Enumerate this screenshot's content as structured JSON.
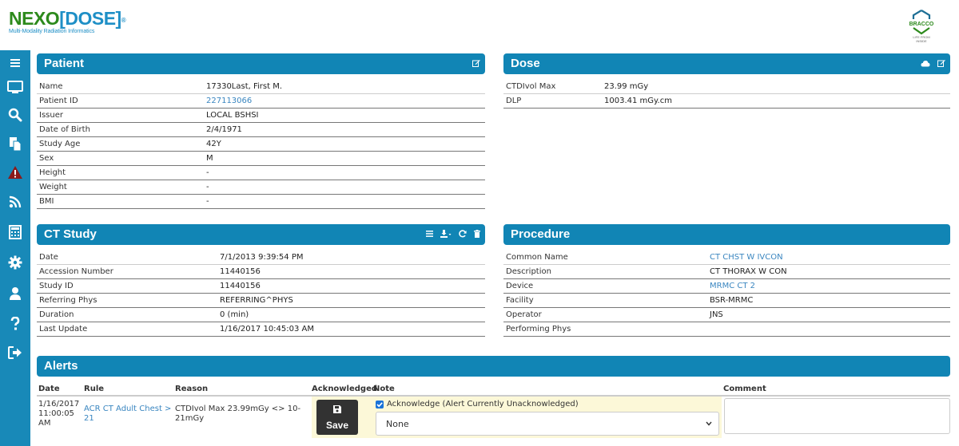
{
  "brand": {
    "logo_nexo": "NEXO",
    "logo_dose": "[DOSE]",
    "logo_reg": "®",
    "tagline": "Multi-Modality Radiation Informatics",
    "partner": "BRACCO",
    "partner_tagline": "LIFE FROM INSIDE"
  },
  "colors": {
    "header_bar": "#1185b5",
    "sidebar": "#1889b8",
    "link": "#3a86c0",
    "highlight_row": "#fcf8d8"
  },
  "sidebar": {
    "items": [
      {
        "name": "menu",
        "icon": "hamburger-icon"
      },
      {
        "name": "monitor",
        "icon": "monitor-icon"
      },
      {
        "name": "search",
        "icon": "search-icon"
      },
      {
        "name": "copy",
        "icon": "copy-icon"
      },
      {
        "name": "alerts",
        "icon": "warning-icon"
      },
      {
        "name": "feed",
        "icon": "rss-icon"
      },
      {
        "name": "calculator",
        "icon": "calculator-icon"
      },
      {
        "name": "settings",
        "icon": "gear-icon"
      },
      {
        "name": "user",
        "icon": "user-icon"
      },
      {
        "name": "help",
        "icon": "question-icon"
      },
      {
        "name": "logout",
        "icon": "sign-out-icon"
      }
    ]
  },
  "patient": {
    "title": "Patient",
    "rows": [
      {
        "label": "Name",
        "value": "17330Last, First M.",
        "link": false
      },
      {
        "label": "Patient ID",
        "value": "227113066",
        "link": true
      },
      {
        "label": "Issuer",
        "value": "LOCAL BSHSI",
        "link": false
      },
      {
        "label": "Date of Birth",
        "value": "2/4/1971",
        "link": false
      },
      {
        "label": "Study Age",
        "value": "42Y",
        "link": false
      },
      {
        "label": "Sex",
        "value": "M",
        "link": false
      },
      {
        "label": "Height",
        "value": "-",
        "link": false
      },
      {
        "label": "Weight",
        "value": "-",
        "link": false
      },
      {
        "label": "BMI",
        "value": "-",
        "link": false
      }
    ]
  },
  "dose": {
    "title": "Dose",
    "rows": [
      {
        "label": "CTDIvol Max",
        "value": "23.99 mGy",
        "link": false
      },
      {
        "label": "DLP",
        "value": "1003.41 mGy.cm",
        "link": false
      }
    ]
  },
  "ct_study": {
    "title": "CT  Study",
    "rows": [
      {
        "label": "Date",
        "value": "7/1/2013 9:39:54 PM",
        "link": false
      },
      {
        "label": "Accession Number",
        "value": "11440156",
        "link": false
      },
      {
        "label": "Study ID",
        "value": "11440156",
        "link": false
      },
      {
        "label": "Referring Phys",
        "value": "REFERRING^PHYS",
        "link": false
      },
      {
        "label": "Duration",
        "value": "0 (min)",
        "link": false
      },
      {
        "label": "Last Update",
        "value": "1/16/2017 10:45:03 AM",
        "link": false
      }
    ]
  },
  "procedure": {
    "title": "Procedure",
    "rows": [
      {
        "label": "Common Name",
        "value": "CT CHST W IVCON",
        "link": true
      },
      {
        "label": "Description",
        "value": "CT THORAX W CON",
        "link": false
      },
      {
        "label": "Device",
        "value": "MRMC CT 2",
        "link": true
      },
      {
        "label": "Facility",
        "value": "BSR-MRMC",
        "link": false
      },
      {
        "label": "Operator",
        "value": "JNS",
        "link": false
      },
      {
        "label": "Performing Phys",
        "value": "",
        "link": false
      }
    ]
  },
  "alerts": {
    "title": "Alerts",
    "columns": {
      "date": "Date",
      "rule": "Rule",
      "reason": "Reason",
      "acknowledged": "Acknowledged",
      "note": "Note",
      "comment": "Comment"
    },
    "row": {
      "date_line1": "1/16/2017",
      "date_line2": "11:00:05",
      "date_line3": "AM",
      "rule_line1": "ACR CT Adult Chest >",
      "rule_line2": "21",
      "reason_line1": "CTDIvol Max 23.99mGy <> 10-",
      "reason_line2": "21mGy",
      "save_label": "Save",
      "ack_checked": true,
      "ack_label": "Acknowledge (Alert Currently Unacknowledged)",
      "note_selected": "None",
      "comment_value": ""
    }
  }
}
